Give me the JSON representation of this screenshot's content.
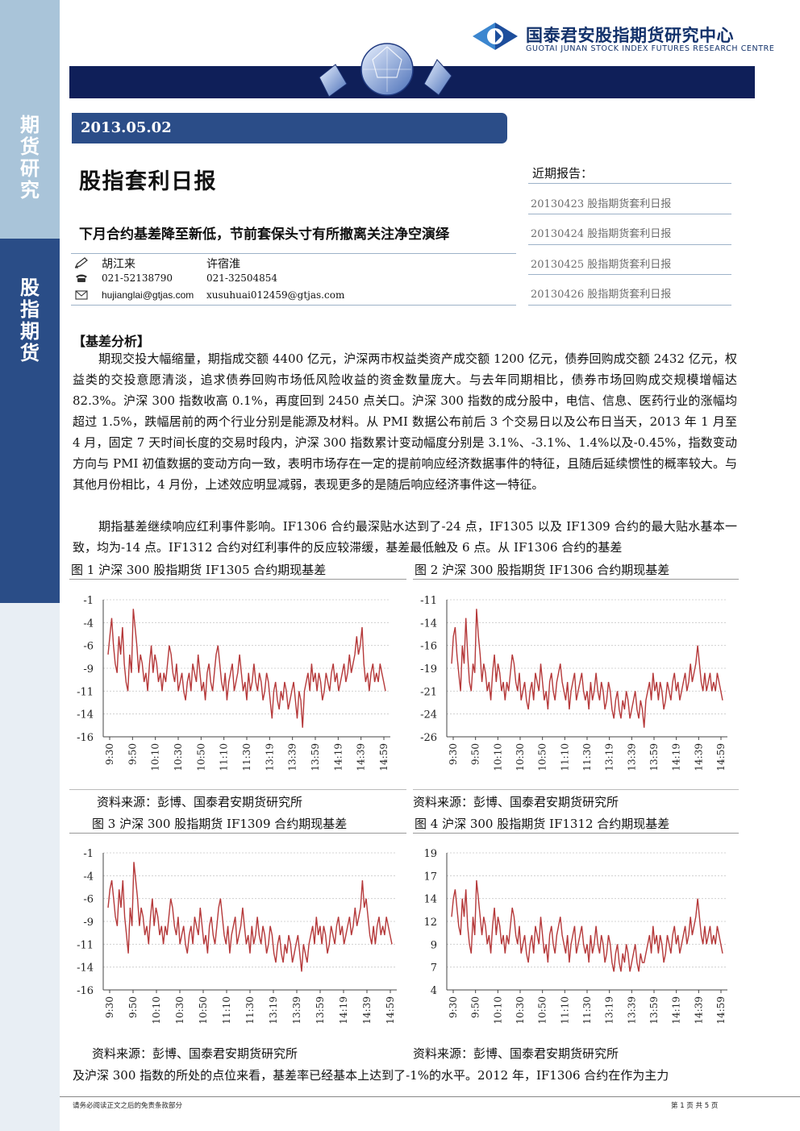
{
  "sidebar": {
    "top_label": "期货研究",
    "mid_label": "股指期货"
  },
  "header": {
    "org_cn": "国泰君安股指期货研究中心",
    "org_en": "GUOTAI JUNAN STOCK INDEX FUTURES RESEARCH CENTRE"
  },
  "report": {
    "date": "2013.05.02",
    "title": "股指套利日报",
    "subtitle": "下月合约基差降至新低，节前套保头寸有所撤离关注净空演绎"
  },
  "authors": [
    {
      "name": "胡江来",
      "phone": "021-52138790",
      "email": "hujianglai@gtjas.com"
    },
    {
      "name": "许宿淮",
      "phone": "021-32504854",
      "email": "xusuhuai012459@gtjas.com"
    }
  ],
  "recent": {
    "title": "近期报告：",
    "items": [
      "20130423 股指期货套利日报",
      "20130424 股指期货套利日报",
      "20130425 股指期货套利日报",
      "20130426 股指期货套利日报"
    ]
  },
  "body": {
    "section_title": "【基差分析】",
    "para1": "期现交投大幅缩量，期指成交额 4400 亿元，沪深两市权益类资产成交额 1200 亿元，债券回购成交额 2432 亿元，权益类的交投意愿清淡，追求债券回购市场低风险收益的资金数量庞大。与去年同期相比，债券市场回购成交规模增幅达 82.3%。沪深 300 指数收高 0.1%，再度回到 2450 点关口。沪深 300 指数的成分股中，电信、信息、医药行业的涨幅均超过 1.5%，跌幅居前的两个行业分别是能源及材料。从 PMI 数据公布前后 3 个交易日以及公布日当天，2013 年 1 月至 4 月，固定 7 天时间长度的交易时段内，沪深 300 指数累计变动幅度分别是 3.1%、-3.1%、1.4%以及-0.45%，指数变动方向与 PMI 初值数据的变动方向一致，表明市场存在一定的提前响应经济数据事件的特征，且随后延续惯性的概率较大。与其他月份相比，4 月份，上述效应明显减弱，表现更多的是随后响应经济事件这一特征。",
    "para2": "期指基差继续响应红利事件影响。IF1306 合约最深贴水达到了-24 点，IF1305 以及 IF1309 合约的最大贴水基本一致，均为-14 点。IF1312 合约对红利事件的反应较滞缓，基差最低触及 6 点。从 IF1306 合约的基差",
    "para3": "及沪深 300 指数的所处的点位来看，基差率已经基本上达到了-1%的水平。2012 年，IF1306 合约在作为主力"
  },
  "figures": [
    {
      "caption": "图 1 沪深 300 股指期货 IF1305 合约期现基差",
      "source": "资料来源：彭博、国泰君安期货研究所"
    },
    {
      "caption": "图 2 沪深 300 股指期货 IF1306 合约期现基差",
      "source": "资料来源：彭博、国泰君安期货研究所"
    },
    {
      "caption": "图 3 沪深 300 股指期货 IF1309 合约期现基差",
      "source": "资料来源：彭博、国泰君安期货研究所"
    },
    {
      "caption": "图 4 沪深 300 股指期货 IF1312 合约期现基差",
      "source": "资料来源：彭博、国泰君安期货研究所"
    }
  ],
  "footer": {
    "left": "请务必阅读正文之后的免责条款部分",
    "right": "第 1 页 共 5 页"
  },
  "colors": {
    "navy": "#0f1f59",
    "sidebar_blue": "#2a4d87",
    "sidebar_light": "#a9c4d9",
    "series": "#b5393a"
  },
  "chart_data": [
    {
      "type": "line",
      "x_ticks": [
        "9:30",
        "9:50",
        "10:10",
        "10:30",
        "10:50",
        "11:10",
        "11:30",
        "13:19",
        "13:39",
        "13:59",
        "14:19",
        "14:39",
        "14:59"
      ],
      "y_ticks": [
        "-1",
        "-4",
        "-6",
        "-9",
        "-11",
        "-14",
        "-16"
      ],
      "ylim": [
        -16,
        -1
      ],
      "grid": true,
      "values": [
        -7,
        -5,
        -3,
        -6,
        -8,
        -9,
        -5,
        -7,
        -4,
        -8,
        -10,
        -11,
        -7,
        -9,
        -2,
        -4,
        -6,
        -9,
        -7,
        -8,
        -10,
        -9,
        -11,
        -8,
        -6,
        -9,
        -7,
        -8,
        -10,
        -9,
        -11,
        -9,
        -10,
        -8,
        -6,
        -7,
        -9,
        -10,
        -8,
        -11,
        -10,
        -9,
        -11,
        -12,
        -10,
        -9,
        -11,
        -8,
        -9,
        -10,
        -7,
        -9,
        -11,
        -10,
        -12,
        -9,
        -8,
        -10,
        -11,
        -9,
        -7,
        -6,
        -8,
        -10,
        -11,
        -9,
        -12,
        -10,
        -9,
        -8,
        -11,
        -10,
        -9,
        -7,
        -9,
        -11,
        -10,
        -12,
        -9,
        -11,
        -10,
        -8,
        -10,
        -11,
        -9,
        -10,
        -12,
        -11,
        -9,
        -10,
        -12,
        -14,
        -11,
        -10,
        -12,
        -13,
        -11,
        -12,
        -10,
        -11,
        -13,
        -12,
        -11,
        -10,
        -12,
        -14,
        -11,
        -12,
        -15,
        -11,
        -10,
        -9,
        -11,
        -8,
        -10,
        -9,
        -11,
        -9,
        -10,
        -12,
        -11,
        -9,
        -10,
        -11,
        -9,
        -8,
        -10,
        -9,
        -11,
        -10,
        -9,
        -8,
        -10,
        -9,
        -7,
        -9,
        -8,
        -7,
        -5,
        -7,
        -6,
        -4,
        -8,
        -10,
        -9,
        -11,
        -9,
        -8,
        -10,
        -9,
        -10,
        -8,
        -9,
        -10,
        -11
      ]
    },
    {
      "type": "line",
      "x_ticks": [
        "9:30",
        "9:50",
        "10:10",
        "10:30",
        "10:50",
        "11:10",
        "11:30",
        "13:19",
        "13:39",
        "13:59",
        "14:19",
        "14:39",
        "14:59"
      ],
      "y_ticks": [
        "-11",
        "-14",
        "-16",
        "-19",
        "-21",
        "-24",
        "-26"
      ],
      "ylim": [
        -26,
        -11
      ],
      "grid": true,
      "values": [
        -18,
        -15,
        -14,
        -17,
        -19,
        -21,
        -16,
        -18,
        -13,
        -17,
        -20,
        -21,
        -18,
        -19,
        -12,
        -15,
        -17,
        -20,
        -18,
        -19,
        -21,
        -20,
        -22,
        -19,
        -17,
        -20,
        -18,
        -19,
        -21,
        -20,
        -22,
        -20,
        -21,
        -19,
        -17,
        -18,
        -20,
        -21,
        -19,
        -22,
        -21,
        -20,
        -22,
        -23,
        -21,
        -20,
        -22,
        -19,
        -20,
        -21,
        -18,
        -20,
        -22,
        -21,
        -23,
        -20,
        -19,
        -21,
        -22,
        -20,
        -19,
        -18,
        -20,
        -21,
        -22,
        -20,
        -23,
        -21,
        -20,
        -19,
        -22,
        -21,
        -20,
        -19,
        -21,
        -22,
        -21,
        -23,
        -20,
        -22,
        -21,
        -19,
        -21,
        -22,
        -20,
        -21,
        -23,
        -22,
        -20,
        -21,
        -23,
        -24,
        -22,
        -21,
        -23,
        -24,
        -22,
        -23,
        -21,
        -22,
        -24,
        -23,
        -22,
        -21,
        -23,
        -24,
        -22,
        -23,
        -25,
        -22,
        -21,
        -20,
        -22,
        -19,
        -21,
        -20,
        -22,
        -20,
        -21,
        -23,
        -22,
        -20,
        -21,
        -22,
        -20,
        -19,
        -21,
        -20,
        -22,
        -21,
        -20,
        -19,
        -21,
        -20,
        -18,
        -20,
        -19,
        -18,
        -16,
        -18,
        -20,
        -21,
        -19,
        -21,
        -20,
        -19,
        -21,
        -20,
        -21,
        -19,
        -20,
        -21,
        -22
      ]
    },
    {
      "type": "line",
      "x_ticks": [
        "9:30",
        "9:50",
        "10:10",
        "10:30",
        "10:50",
        "11:10",
        "11:30",
        "13:19",
        "13:39",
        "13:59",
        "14:19",
        "14:39",
        "14:59"
      ],
      "y_ticks": [
        "-1",
        "-4",
        "-6",
        "-9",
        "-11",
        "-14",
        "-16"
      ],
      "ylim": [
        -16,
        -1
      ],
      "grid": true,
      "values": [
        -7,
        -5,
        -4,
        -6,
        -8,
        -9,
        -5,
        -7,
        -4,
        -8,
        -10,
        -12,
        -7,
        -9,
        -2,
        -4,
        -6,
        -9,
        -7,
        -8,
        -10,
        -9,
        -11,
        -8,
        -6,
        -9,
        -7,
        -8,
        -10,
        -9,
        -11,
        -9,
        -10,
        -8,
        -6,
        -7,
        -9,
        -10,
        -8,
        -11,
        -10,
        -9,
        -11,
        -12,
        -10,
        -9,
        -11,
        -8,
        -9,
        -10,
        -7,
        -9,
        -11,
        -10,
        -12,
        -9,
        -8,
        -10,
        -11,
        -9,
        -7,
        -6,
        -8,
        -10,
        -11,
        -9,
        -12,
        -10,
        -9,
        -8,
        -11,
        -10,
        -9,
        -7,
        -9,
        -11,
        -10,
        -12,
        -9,
        -11,
        -10,
        -8,
        -10,
        -11,
        -9,
        -10,
        -12,
        -11,
        -9,
        -10,
        -12,
        -13,
        -11,
        -10,
        -12,
        -13,
        -11,
        -12,
        -10,
        -11,
        -13,
        -12,
        -11,
        -10,
        -12,
        -14,
        -11,
        -12,
        -13,
        -11,
        -10,
        -9,
        -11,
        -8,
        -10,
        -9,
        -11,
        -9,
        -10,
        -12,
        -11,
        -9,
        -10,
        -11,
        -9,
        -8,
        -10,
        -9,
        -11,
        -10,
        -9,
        -8,
        -10,
        -9,
        -7,
        -9,
        -8,
        -7,
        -4,
        -7,
        -6,
        -8,
        -10,
        -11,
        -9,
        -11,
        -9,
        -8,
        -10,
        -9,
        -10,
        -8,
        -9,
        -10,
        -11
      ]
    },
    {
      "type": "line",
      "x_ticks": [
        "9:30",
        "9:50",
        "10:10",
        "10:30",
        "10:50",
        "11:10",
        "11:30",
        "13:19",
        "13:39",
        "13:59",
        "14:19",
        "14:39",
        "14:59"
      ],
      "y_ticks": [
        "19",
        "17",
        "14",
        "12",
        "9",
        "7",
        "4"
      ],
      "ylim": [
        4,
        19
      ],
      "grid": true,
      "values": [
        12,
        14,
        15,
        13,
        11,
        10,
        14,
        12,
        15,
        11,
        9,
        8,
        12,
        10,
        16,
        14,
        12,
        10,
        12,
        11,
        9,
        10,
        8,
        11,
        13,
        10,
        12,
        11,
        9,
        10,
        8,
        10,
        9,
        11,
        13,
        12,
        10,
        9,
        11,
        8,
        9,
        10,
        8,
        7,
        9,
        10,
        8,
        11,
        10,
        9,
        12,
        10,
        8,
        9,
        7,
        10,
        11,
        9,
        8,
        10,
        11,
        12,
        10,
        9,
        8,
        10,
        7,
        9,
        10,
        11,
        8,
        9,
        10,
        11,
        9,
        8,
        9,
        7,
        10,
        8,
        9,
        11,
        9,
        8,
        10,
        9,
        7,
        8,
        10,
        9,
        7,
        6,
        8,
        9,
        7,
        6,
        8,
        7,
        9,
        8,
        6,
        7,
        8,
        9,
        7,
        6,
        8,
        7,
        7,
        8,
        9,
        10,
        8,
        11,
        9,
        10,
        8,
        10,
        9,
        7,
        8,
        10,
        9,
        8,
        10,
        11,
        9,
        10,
        8,
        9,
        10,
        11,
        9,
        10,
        12,
        10,
        11,
        12,
        14,
        12,
        10,
        9,
        11,
        9,
        10,
        11,
        9,
        10,
        9,
        11,
        10,
        9,
        8
      ]
    }
  ]
}
